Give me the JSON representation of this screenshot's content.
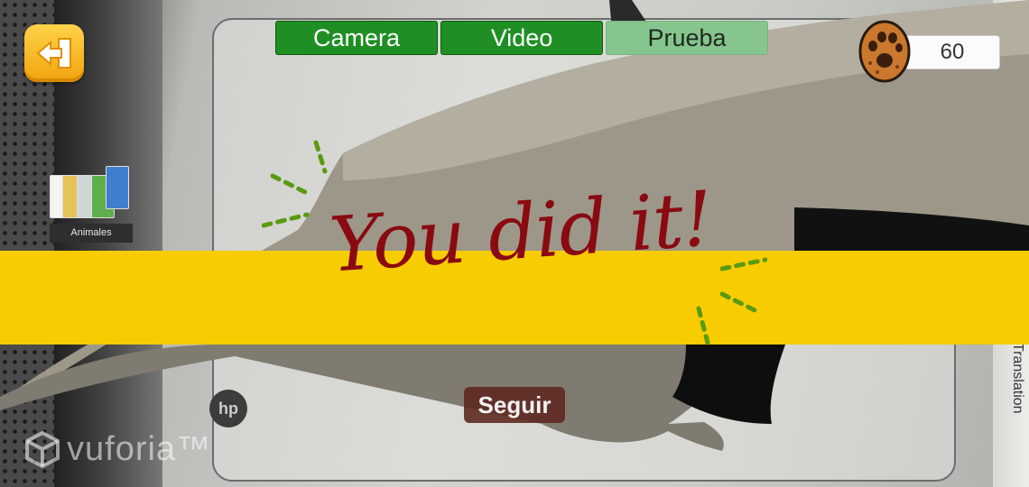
{
  "tabs": [
    {
      "label": "Camera"
    },
    {
      "label": "Video"
    },
    {
      "label": "Prueba"
    }
  ],
  "score": {
    "value": "60",
    "icon": "cookie-icon"
  },
  "collection": {
    "label": "Animales"
  },
  "message": {
    "text": "You did it!"
  },
  "continue_button": {
    "label": "Seguir"
  },
  "watermark": {
    "text": "vuforia™"
  },
  "bezel_text": "Translation",
  "colors": {
    "banner": "#f7cc00",
    "message": "#8a0a12",
    "tab_active": "#1f8f24",
    "tab_inactive": "#86c58d",
    "back_button": "#f1a30e",
    "continue_button": "#5e2a22"
  }
}
